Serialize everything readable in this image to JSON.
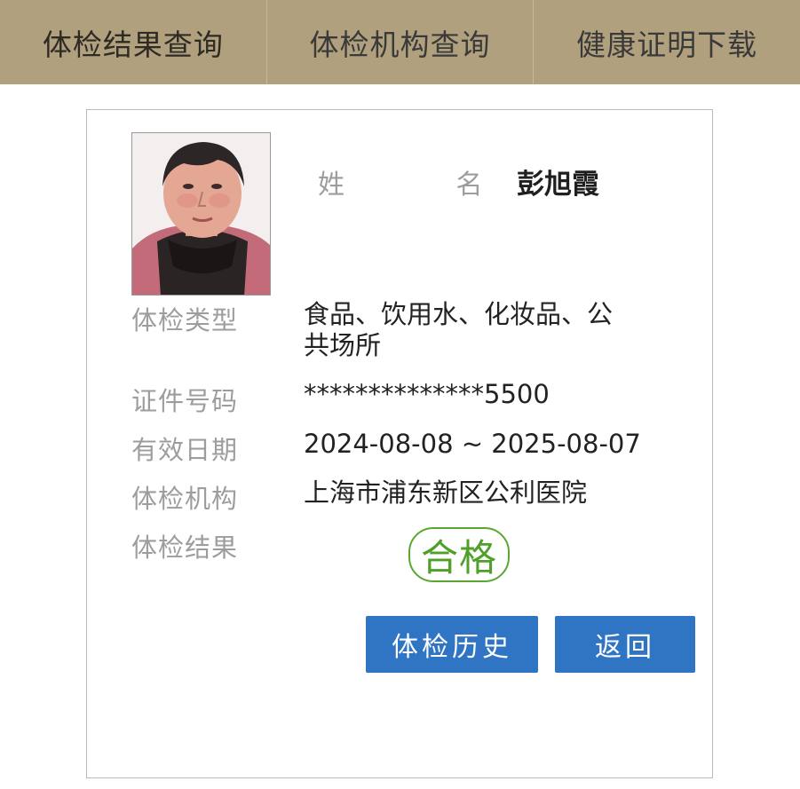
{
  "nav": {
    "tabs": [
      {
        "label": "体检结果查询"
      },
      {
        "label": "体检机构查询"
      },
      {
        "label": "健康证明下载"
      }
    ]
  },
  "person": {
    "name_label": "姓 名",
    "name": "彭旭霞"
  },
  "fields": [
    {
      "label": "体检类型",
      "value_line1": "食品、饮用水、化妆品、公",
      "value_line2": "共场所"
    },
    {
      "label": "证件号码",
      "value": "**************5500"
    },
    {
      "label": "有效日期",
      "value": "2024-08-08 ~ 2025-08-07"
    },
    {
      "label": "体检机构",
      "value": "上海市浦东新区公利医院"
    },
    {
      "label": "体检结果",
      "value": "合格"
    }
  ],
  "buttons": {
    "history": "体检历史",
    "back": "返回"
  },
  "colors": {
    "nav_bg": "#b0a07e",
    "button_bg": "#2f75c4",
    "stamp_green": "#4fa028"
  },
  "icons": {
    "photo": "person-photo"
  }
}
